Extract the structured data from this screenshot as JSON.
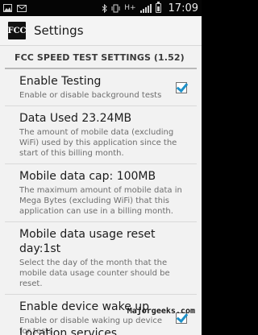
{
  "statusbar": {
    "left_icons": [
      "picture-icon",
      "mail-icon"
    ],
    "right_icons": [
      "bluetooth-icon",
      "vibrate-icon",
      "hplus-icon",
      "signal-icon",
      "battery-icon"
    ],
    "network_label": "H+",
    "time": "17:09"
  },
  "actionbar": {
    "logo_text": "FCC",
    "title": "Settings"
  },
  "section_header": "FCC SPEED TEST SETTINGS (1.52)",
  "prefs": [
    {
      "title": "Enable Testing",
      "summary": "Enable or disable background tests",
      "checked": true
    },
    {
      "title": "Data Used 23.24MB",
      "summary": "The amount of mobile data (excluding WiFi) used by this application since the start of this billing month."
    },
    {
      "title": "Mobile data cap: 100MB",
      "summary": "The maximum amount of mobile data in Mega Bytes (excluding WiFi) that this application can use in a billing month."
    },
    {
      "title": "Mobile data usage reset day:1st",
      "summary": "Select the day of the month that the mobile data usage counter should be reset."
    },
    {
      "title": "Enable device wake up",
      "summary": "Enable or disable waking up device for tests",
      "checked": true
    }
  ],
  "partial_item": "Location services",
  "watermark": "Majorgeeks.com",
  "colors": {
    "checkbox_accent": "#1e90c8",
    "statusbar_bg": "#050505"
  }
}
